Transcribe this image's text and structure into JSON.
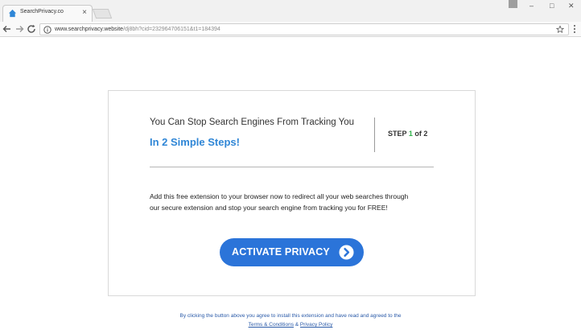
{
  "browser": {
    "tab_title": "SearchPrivacy.co",
    "tab_close": "×",
    "url_host": "www.searchprivacy.website",
    "url_path": "/dj8bh?cid=232964706151&t1=184394",
    "window_controls": {
      "minimize": "–",
      "maximize": "□",
      "close": "✕"
    }
  },
  "card": {
    "headline_line1": "You Can Stop Search Engines From Tracking You",
    "headline_line2": "In 2 Simple Steps!",
    "step_prefix": "STEP ",
    "step_current": "1",
    "step_suffix": " of 2",
    "body": "Add this free extension to your browser now to redirect all your web searches through our secure extension and stop your search engine from tracking you for FREE!",
    "cta_label": "ACTIVATE PRIVACY"
  },
  "footer": {
    "line1": "By clicking the button above you agree to install this extension and have read and agreed to the",
    "terms_label": "Terms & Conditions",
    "amp": " & ",
    "privacy_label": "Privacy Policy"
  },
  "colors": {
    "accent_blue": "#2b74d9",
    "headline_blue": "#2f86d6",
    "step_green": "#2fb24a",
    "footer_link": "#2a5aa8"
  },
  "icons": {
    "tab_favicon": "home-icon",
    "back": "back-arrow-icon",
    "forward": "forward-arrow-icon",
    "reload": "reload-icon",
    "site_info": "info-icon",
    "bookmark": "star-icon",
    "menu": "kebab-menu-icon",
    "cta_arrow": "chevron-right-circle-icon"
  }
}
